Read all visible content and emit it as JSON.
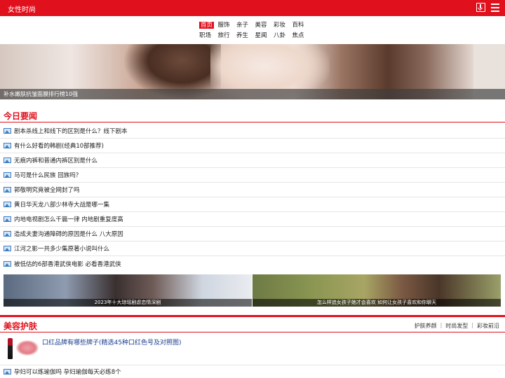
{
  "header": {
    "title": "女性时尚",
    "download_icon": "download-icon",
    "menu_icon": "menu-icon"
  },
  "nav": {
    "rows": [
      [
        "首页",
        "服饰",
        "亲子",
        "美容",
        "彩妆",
        "百科"
      ],
      [
        "职场",
        "旅行",
        "养生",
        "星闻",
        "八卦",
        "焦点"
      ]
    ],
    "active": "首页"
  },
  "banner": {
    "caption": "补水嫩肤抗皱面膜排行榜10强"
  },
  "today_news": {
    "title": "今日要闻",
    "items": [
      "剧本杀线上和线下的区别是什么？线下剧本",
      "有什么好看的韩剧(经典10部推荐)",
      "无痕内裤和普通内裤区别是什么",
      "马可是什么民族 回族吗？",
      "郭敬明究竟被全网封了吗",
      "黄日华天龙八部少林寺大战是哪一集",
      "内地电视剧怎么千篇一律 内地剧重复度高",
      "造成夫妻沟通障碍的原因是什么 八大原因",
      "江河之影一共多少集原著小说叫什么",
      "被低估的6部香港武侠电影 必看香港武侠"
    ],
    "photos": [
      {
        "caption": "2023年十大琼瑶剧虐恋情深剧"
      },
      {
        "caption": "怎么样追女孩子她才会喜欢 如何让女孩子喜欢和你聊天"
      }
    ]
  },
  "beauty": {
    "title": "美容护肤",
    "links": [
      "护肤养颜",
      "时尚发型",
      "彩妆前沿"
    ],
    "feature_title": "口红品牌有哪些牌子(精选45种口红色号及对照图)",
    "items": [
      "孕妇可以练瑜伽吗 孕妇瑜伽每天必练8个"
    ]
  },
  "colors": {
    "brand": "#e0101c",
    "link": "#1a3d8f"
  }
}
